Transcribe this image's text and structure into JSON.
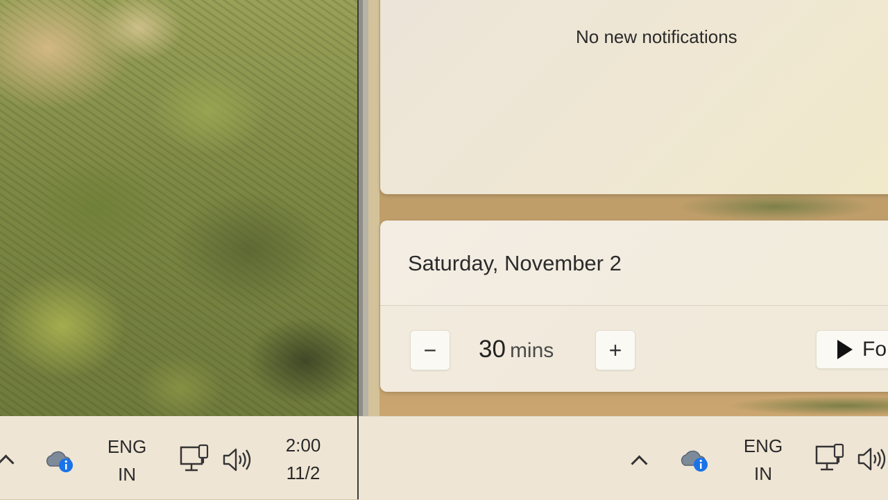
{
  "notifications": {
    "empty_text": "No new notifications"
  },
  "calendar": {
    "date": "Saturday, November 2",
    "focus": {
      "minutes": "30",
      "unit": "mins",
      "decrease_label": "−",
      "increase_label": "+",
      "start_label": "Fo"
    }
  },
  "taskbar_left": {
    "language": {
      "line1": "ENG",
      "line2": "IN"
    },
    "clock": {
      "time": "2:00",
      "date": "11/2"
    }
  },
  "taskbar_right": {
    "language": {
      "line1": "ENG",
      "line2": "IN"
    }
  },
  "icons": [
    "chevron-up-icon",
    "onedrive-info-icon",
    "network-icon",
    "volume-icon",
    "play-icon"
  ],
  "colors": {
    "taskbar": "#efe5d5",
    "panel": "#f2ebd9",
    "info_badge": "#1a73e8"
  }
}
